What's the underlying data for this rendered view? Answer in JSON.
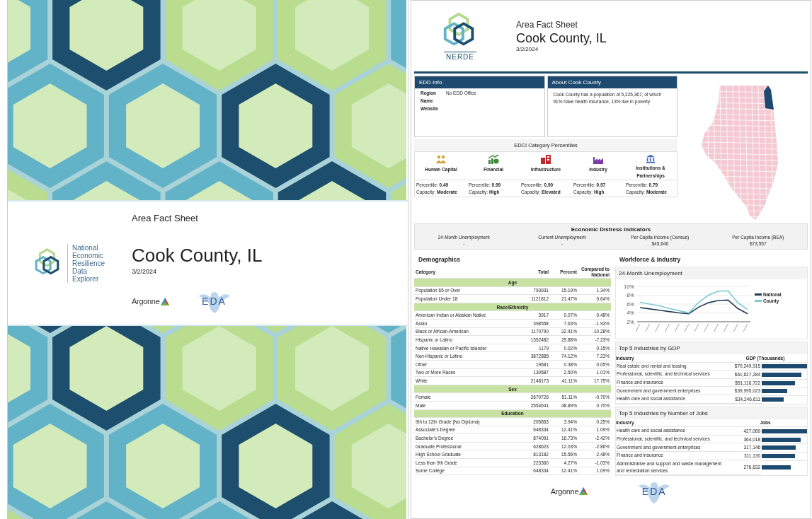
{
  "cover": {
    "title": "Area Fact Sheet",
    "county": "Cook County, IL",
    "date": "3/2/2024",
    "logo_text": [
      "National",
      "Economic",
      "Resilience",
      "Data",
      "Explorer"
    ],
    "partner_logos": [
      "Argonne",
      "EDA"
    ]
  },
  "report": {
    "logo_text": "NERDE",
    "title": "Area Fact Sheet",
    "county": "Cook County, IL",
    "date": "3/2/2024",
    "edd_info": {
      "heading": "EDD Info",
      "rows": [
        {
          "label": "Region",
          "value": "No EDD Office"
        },
        {
          "label": "Name"
        },
        {
          "label": "Website"
        }
      ]
    },
    "about": {
      "heading": "About Cook County",
      "text": "Cook County has a population of 5,225,367, of which 91% have health insurance, 13% live in poverty."
    },
    "edci": {
      "heading": "EDCI Category Percentiles",
      "categories": [
        {
          "kind": "people",
          "color": "#d4a23c",
          "name": "Human Capital",
          "percentile_label": "Percentile:",
          "percentile": "0.49",
          "capacity_label": "Capacity:",
          "capacity": "Moderate"
        },
        {
          "kind": "money",
          "color": "#3f8a3a",
          "name": "Financial",
          "percentile_label": "Percentile:",
          "percentile": "0.99",
          "capacity_label": "Capacity:",
          "capacity": "High"
        },
        {
          "kind": "infrastructure",
          "color": "#c0282e",
          "name": "Infrastructure",
          "percentile_label": "Percentile:",
          "percentile": "0.90",
          "capacity_label": "Capacity:",
          "capacity": "Elevated"
        },
        {
          "kind": "factory",
          "color": "#7b3aa6",
          "name": "Industry",
          "percentile_label": "Percentile:",
          "percentile": "0.97",
          "capacity_label": "Capacity:",
          "capacity": "High"
        },
        {
          "kind": "institution",
          "color": "#3b66b8",
          "name": "Institutions & Partnerships",
          "percentile_label": "Percentile:",
          "percentile": "0.79",
          "capacity_label": "Capacity:",
          "capacity": "Moderate"
        }
      ]
    },
    "distress": {
      "heading": "Economic Distress Indicators",
      "indicators": [
        {
          "label": "24-Month Unemployment",
          "value": "-"
        },
        {
          "label": "Current Unemployment",
          "value": "-"
        },
        {
          "label": "Per Capita Income (Census)",
          "value": "$45,646"
        },
        {
          "label": "Per Capita Income (BEA)",
          "value": "$73,557"
        }
      ]
    },
    "demographics": {
      "heading": "Demographics",
      "columns": [
        "Category",
        "Total",
        "Percent",
        "Compared to National"
      ],
      "groups": [
        {
          "name": "Age",
          "rows": [
            [
              "Population 65 or Over",
              "793931",
              "15.19%",
              "1.34%"
            ],
            [
              "Population Under 18",
              "1121812",
              "21.47%",
              "0.64%"
            ]
          ]
        },
        {
          "name": "Race/Ethnicity",
          "rows": [
            [
              "American Indian or Alaskan Native",
              "3917",
              "0.07%",
              "0.48%"
            ],
            [
              "Asian",
              "398558",
              "7.63%",
              "-1.93%"
            ],
            [
              "Black or African-American",
              "1170790",
              "22.41%",
              "-10.28%"
            ],
            [
              "Hispanic or Latino",
              "1352482",
              "25.88%",
              "-7.23%"
            ],
            [
              "Native Hawaiian or Pacific Islander",
              "1179",
              "0.02%",
              "0.15%"
            ],
            [
              "Non-Hispanic or Latino",
              "3872885",
              "74.12%",
              "7.23%"
            ],
            [
              "Other",
              "19681",
              "0.38%",
              "0.05%"
            ],
            [
              "Two or More Races",
              "130587",
              "2.50%",
              "1.01%"
            ],
            [
              "White",
              "2148173",
              "41.11%",
              "17.75%"
            ]
          ]
        },
        {
          "name": "Sex",
          "rows": [
            [
              "Female",
              "2670726",
              "51.11%",
              "-0.70%"
            ],
            [
              "Male",
              "2554641",
              "48.89%",
              "0.70%"
            ]
          ]
        },
        {
          "name": "Education",
          "rows": [
            [
              "9th to 12th Grade (No Diploma)",
              "205853",
              "3.94%",
              "0.25%"
            ],
            [
              "Associate's Degree",
              "648334",
              "12.41%",
              "1.09%"
            ],
            [
              "Bachelor's Degree",
              "874091",
              "16.73%",
              "-2.42%"
            ],
            [
              "Graduate Professional",
              "628623",
              "12.03%",
              "-2.86%"
            ],
            [
              "High School Graduate",
              "813182",
              "15.56%",
              "2.48%"
            ],
            [
              "Less than 9th Grade",
              "223360",
              "4.27%",
              "-1.03%"
            ],
            [
              "Some College",
              "648334",
              "12.41%",
              "1.09%"
            ]
          ]
        }
      ]
    },
    "workforce": {
      "heading": "Workforce & Industry",
      "unemployment": {
        "title": "24-Month Unemployment",
        "chart_data": {
          "type": "line",
          "grid": true,
          "legend": true,
          "ylim": [
            2,
            10
          ],
          "yticks": [
            {
              "value": 10,
              "label": "10%"
            },
            {
              "value": 8,
              "label": "8%"
            },
            {
              "value": 6,
              "label": "6%"
            },
            {
              "value": 4,
              "label": "4%"
            },
            {
              "value": 2,
              "label": "2%"
            }
          ],
          "series": [
            {
              "name": "National",
              "color": "#1f3b55",
              "values": [
                5.2,
                4.9,
                4.6,
                4.3,
                4.0,
                3.8,
                5.3,
                6.3,
                6.8,
                6.9,
                5.0,
                3.8
              ]
            },
            {
              "name": "County",
              "color": "#7ccad4",
              "values": [
                6.4,
                6.0,
                5.6,
                5.0,
                4.5,
                4.0,
                6.4,
                8.0,
                8.9,
                9.0,
                6.3,
                4.8
              ]
            }
          ]
        }
      },
      "gdp": {
        "title": "Top 5 Industries by GDP",
        "columns": [
          "Industry",
          "GDP (Thousands)"
        ],
        "rows": [
          {
            "industry": "Real estate and rental and leasing",
            "value": "$70,249,915",
            "level": 1
          },
          {
            "industry": "Professional, scientific, and technical services",
            "value": "$61,627,284",
            "level": 0.877
          },
          {
            "industry": "Finance and insurance",
            "value": "$51,116,722",
            "level": 0.728
          },
          {
            "industry": "Government and government enterprises",
            "value": "$39,995,023",
            "level": 0.569
          },
          {
            "industry": "Health care and social assistance",
            "value": "$34,246,611",
            "level": 0.487
          }
        ]
      },
      "jobs": {
        "title": "Top 5 Industries by Number of Jobs",
        "columns": [
          "Industry",
          "Jobs"
        ],
        "rows": [
          {
            "industry": "Health care and social assistance",
            "value": "427,089",
            "level": 1
          },
          {
            "industry": "Professional, scientific, and technical services",
            "value": "364,018",
            "level": 0.852
          },
          {
            "industry": "Government and government enterprises",
            "value": "317,146",
            "level": 0.743
          },
          {
            "industry": "Finance and insurance",
            "value": "311,130",
            "level": 0.728
          },
          {
            "industry": "Administrative and support and waste management and remediation services",
            "value": "276,632",
            "level": 0.648
          }
        ]
      }
    },
    "partner_logos": [
      "Argonne",
      "EDA"
    ]
  }
}
